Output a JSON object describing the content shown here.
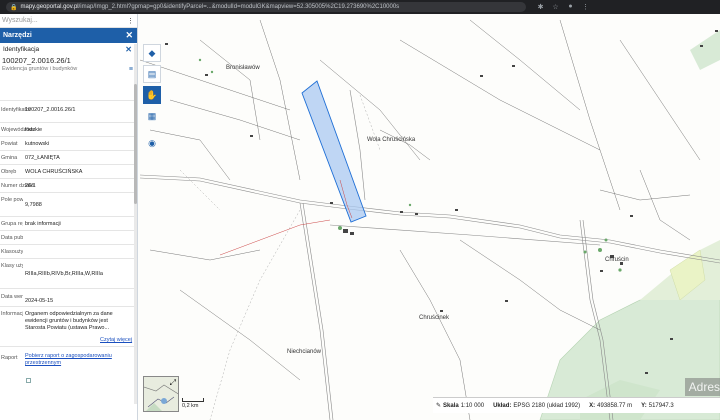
{
  "browser": {
    "url_host": "mapy.geoportal.gov.pl",
    "url_rest": "/imap/Imgp_2.html?gpmap=gp0&identifyParcel=...&modulId=modulGK&mapview=52.305005%2C19.273690%2C10000s",
    "extensions": [
      "puzzle-icon",
      "star-icon",
      "profile-icon",
      "menu-icon"
    ]
  },
  "sidebar": {
    "search_placeholder": "Wyszukaj...",
    "tools_title": "Narzędzi",
    "identification_title": "Identyfikacja",
    "parcel_id": "100207_2.0016.26/1",
    "subtitle": "Ewidencja gruntów i budynków",
    "attributes": [
      {
        "label": "Identyfikator",
        "value": "100207_2.0016.26/1"
      },
      {
        "label": "Województwo",
        "value": "łódzkie"
      },
      {
        "label": "Powiat",
        "value": "kutnowski"
      },
      {
        "label": "Gmina",
        "value": "072_ŁANIĘTA"
      },
      {
        "label": "Obręb",
        "value": "WOLA CHRUŚCIŃSKA"
      },
      {
        "label": "Numer działki",
        "value": "26/1"
      },
      {
        "label": "Pole pow. w ewidencji gruntów",
        "value": "9,7988"
      },
      {
        "label": "Grupa rejestrowa",
        "value": "brak informacji"
      },
      {
        "label": "Data publikacji",
        "value": ""
      },
      {
        "label": "Klasoużytki",
        "value": ""
      },
      {
        "label": "Klasy użytku",
        "value": "RIIIa,RIIIb,RIVb,Br,RIIIa,W,RIIIa"
      },
      {
        "label": "Data weryfikacji",
        "value": "2024-05-15"
      },
      {
        "label": "Informacja o danych",
        "value": "Organem odpowiedzialnym za dane ewidencji gruntów i budynków jest Starosta Powiatu (ustawa Prawo..."
      },
      {
        "label": "Raport",
        "value": "Pobierz raport o zagospodarowaniu przestrzennym"
      }
    ],
    "read_more": "Czytaj więcej"
  },
  "toolbar": {
    "items": [
      "layers-icon",
      "print-icon",
      "measure-icon",
      "list-icon",
      "camera-icon"
    ]
  },
  "map": {
    "places": [
      "Bronisławów",
      "Wola Chruścińska",
      "Chruścinek",
      "Niechcianów",
      "Chruścin"
    ],
    "parcel_color": "#1f6fd6",
    "scale_label": "0,2 km"
  },
  "status": {
    "scale_label": "Skala",
    "scale_value": "1:10 000",
    "crs_label": "Układ:",
    "crs_value": "EPSG 2180 (układ 1992)",
    "x_label": "X:",
    "x_value": "493858.77 m",
    "y_label": "Y:",
    "y_value": "517947.3",
    "watermark": "Adres"
  }
}
